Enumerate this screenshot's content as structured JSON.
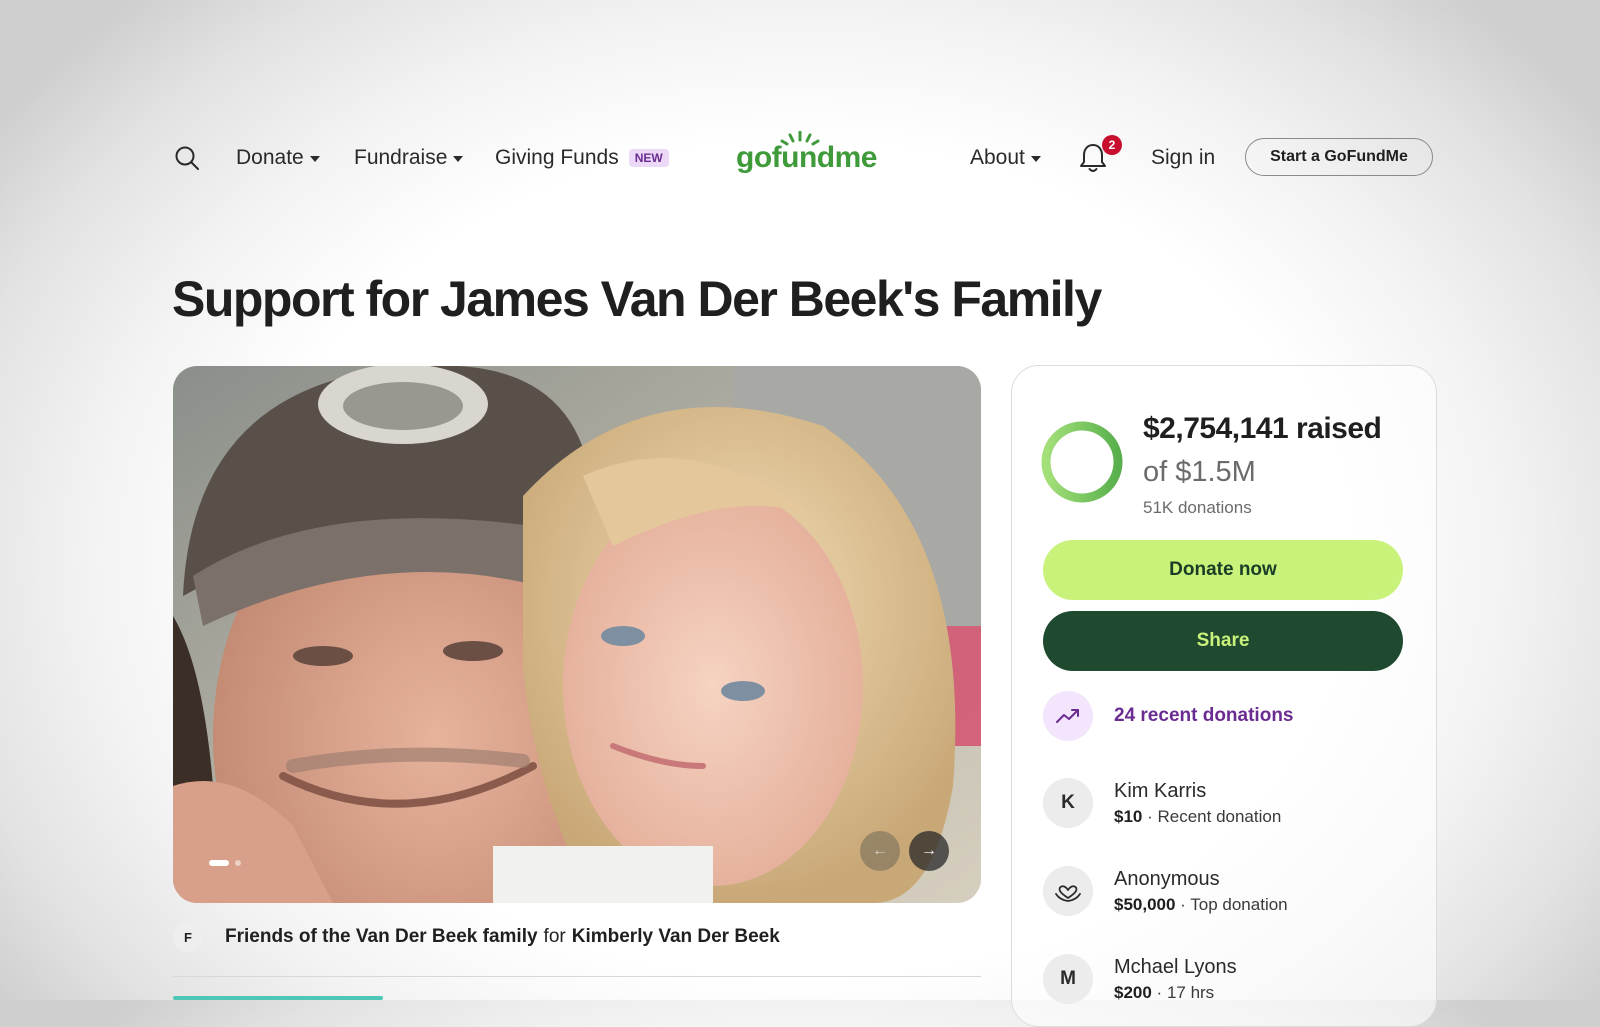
{
  "nav": {
    "donate_label": "Donate",
    "fundraise_label": "Fundraise",
    "giving_funds_label": "Giving Funds",
    "giving_funds_badge": "NEW",
    "logo_text": "gofundme",
    "about_label": "About",
    "notification_count": "2",
    "sign_in_label": "Sign in",
    "start_label": "Start a GoFundMe"
  },
  "campaign": {
    "title": "Support for James Van Der Beek's Family",
    "organizer_initial": "F",
    "organizer_name": "Friends of the Van Der Beek family",
    "organizer_for": "for",
    "beneficiary": "Kimberly Van Der Beek",
    "photo_arrow_prev": "←",
    "photo_arrow_next": "→"
  },
  "donation_card": {
    "raised_text": "$2,754,141 raised",
    "goal_text": "of $1.5M",
    "donations_count": "51K donations",
    "progress_fraction": 1.0,
    "donate_label": "Donate now",
    "share_label": "Share",
    "recent_label": "24 recent donations",
    "donors": [
      {
        "initial": "K",
        "name": "Kim Karris",
        "amount": "$10",
        "note": "Recent donation"
      },
      {
        "initial": "",
        "icon": "heart-hand-icon",
        "name": "Anonymous",
        "amount": "$50,000",
        "note": "Top donation"
      },
      {
        "initial": "M",
        "name": "Mchael Lyons",
        "amount": "$200",
        "note": "17 hrs"
      }
    ]
  },
  "colors": {
    "brand_green": "#3f9a3a",
    "donate_button": "#c9f27b",
    "share_button": "#1f4a30",
    "recent_purple": "#6b2c91",
    "notification_red": "#c8102e"
  }
}
